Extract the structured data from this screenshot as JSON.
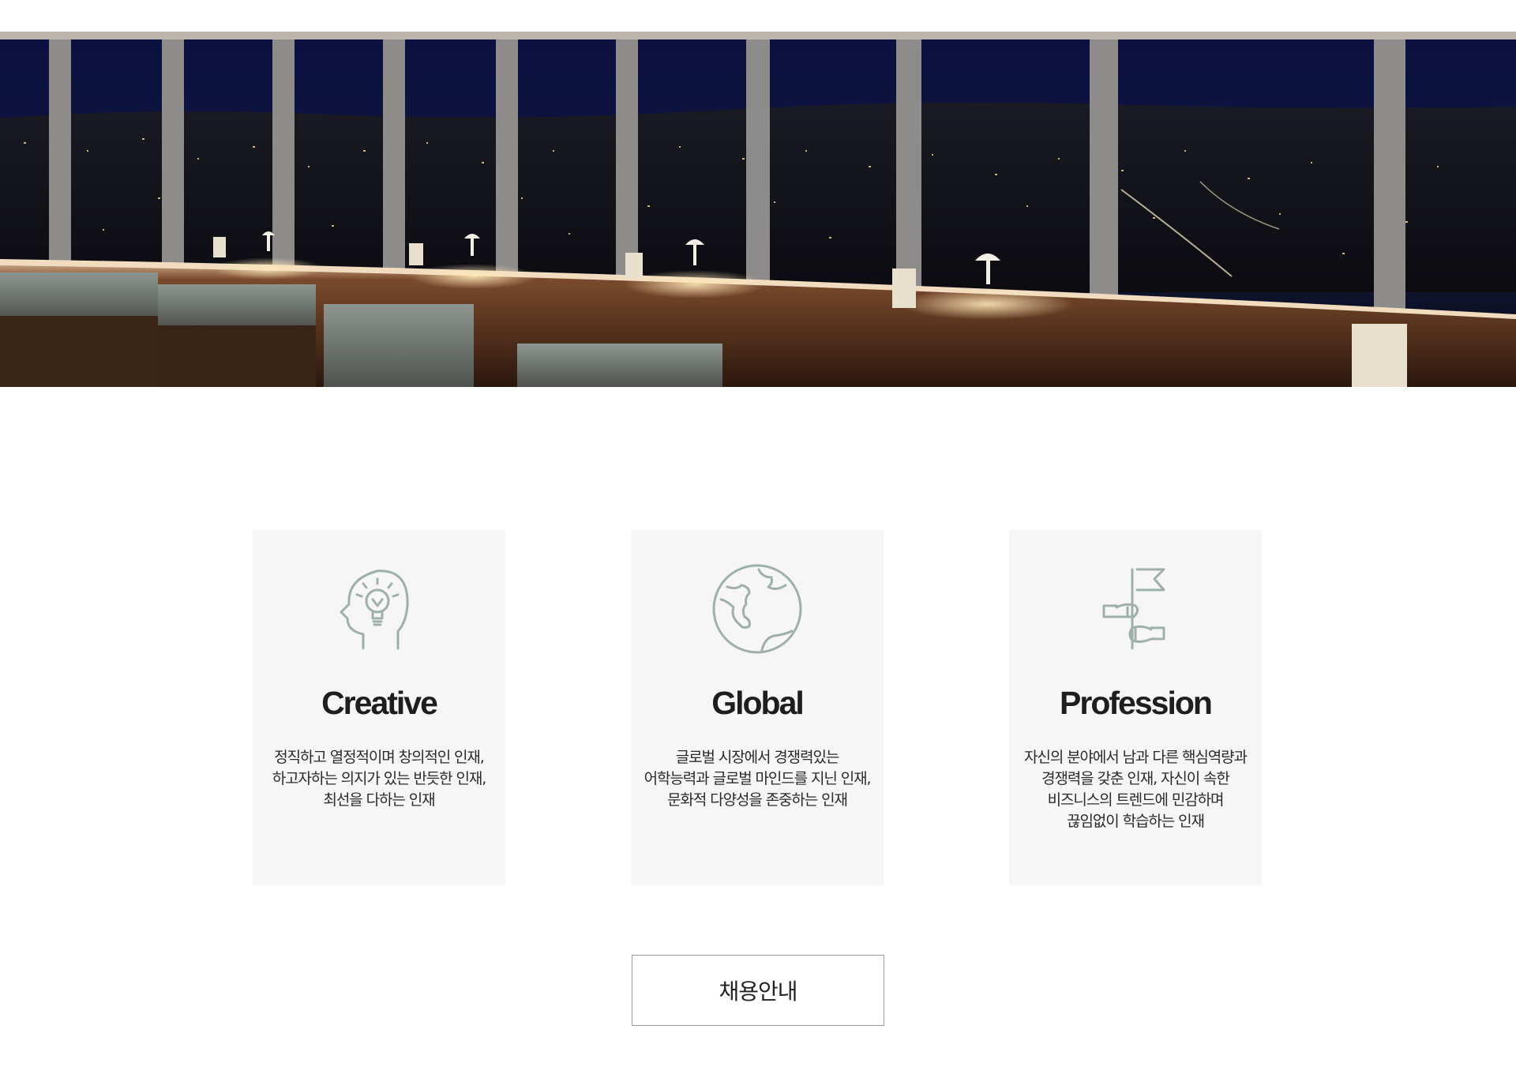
{
  "hero": {
    "image_label": "night-city-lounge-photo"
  },
  "cards": [
    {
      "icon": "lightbulb-head-icon",
      "title": "Creative",
      "description": "정직하고 열정적이며 창의적인 인재, 하고자하는 의지가 있는 반듯한 인재, 최선을 다하는 인재"
    },
    {
      "icon": "globe-icon",
      "title": "Global",
      "description": "글로벌 시장에서 경쟁력있는 어학능력과 글로벌 마인드를 지닌 인재, 문화적 다양성을 존중하는 인재"
    },
    {
      "icon": "flag-hands-icon",
      "title": "Profession",
      "description": "자신의 분야에서 남과 다른 핵심역량과 경쟁력을 갖춘 인재, 자신이 속한 비즈니스의 트렌드에 민감하며 끊임없이 학습하는 인재"
    }
  ],
  "button": {
    "label": "채용안내"
  },
  "colors": {
    "icon_stroke": "#9fb0ab",
    "card_bg": "#f6f6f6",
    "button_border": "#9a9a9a"
  }
}
